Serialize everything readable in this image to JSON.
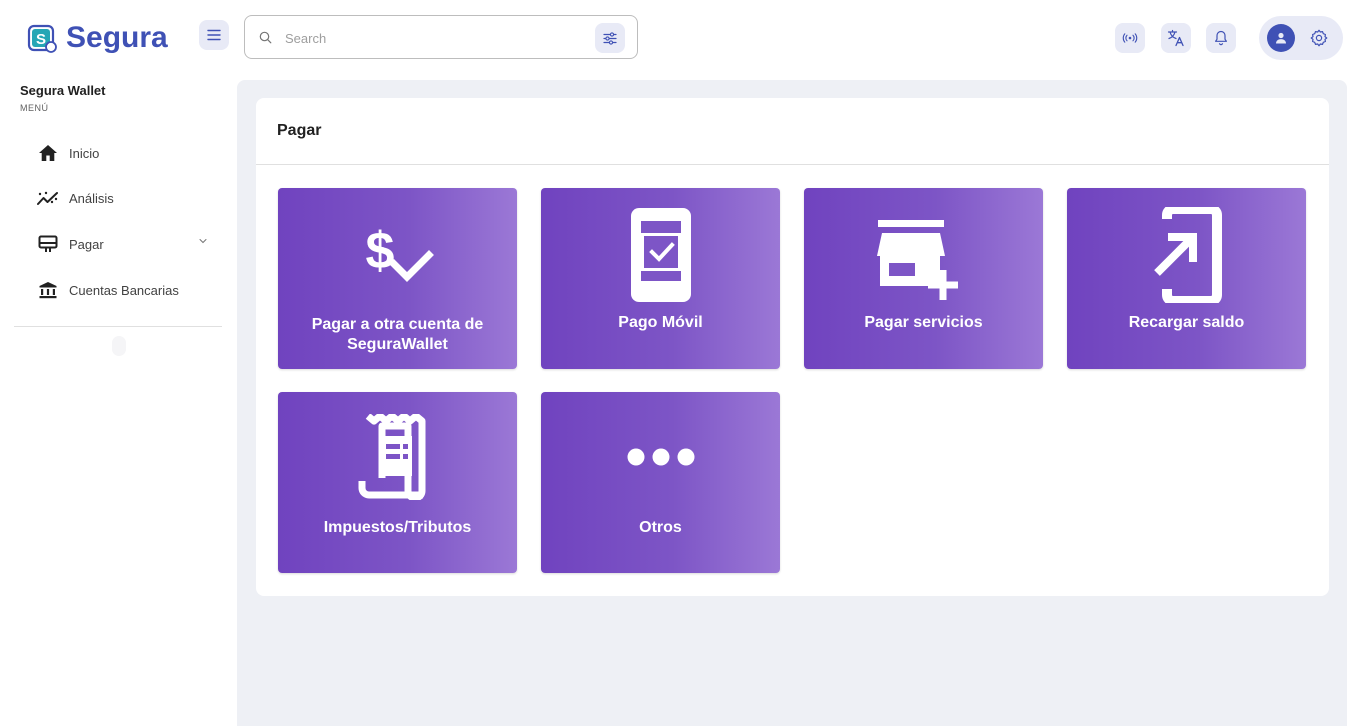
{
  "app": {
    "name": "Segura"
  },
  "search": {
    "placeholder": "Search",
    "value": ""
  },
  "sidebar": {
    "title": "Segura Wallet",
    "subtitle": "MENÚ",
    "items": [
      {
        "label": "Inicio",
        "icon": "home-icon"
      },
      {
        "label": "Análisis",
        "icon": "analytics-icon"
      },
      {
        "label": "Pagar",
        "icon": "payment-icon",
        "expandable": true
      },
      {
        "label": "Cuentas Bancarias",
        "icon": "bank-icon"
      }
    ]
  },
  "page": {
    "title": "Pagar",
    "tiles": [
      {
        "label": "Pagar a otra cuenta de SeguraWallet",
        "icon": "dollar-check-icon"
      },
      {
        "label": "Pago Móvil",
        "icon": "mobile-check-icon"
      },
      {
        "label": "Pagar servicios",
        "icon": "store-add-icon"
      },
      {
        "label": "Recargar saldo",
        "icon": "login-arrow-icon"
      },
      {
        "label": "Impuestos/Tributos",
        "icon": "receipt-icon"
      },
      {
        "label": "Otros",
        "icon": "more-horizontal-icon"
      }
    ]
  },
  "colors": {
    "brand": "#3f51b5",
    "tile_gradient_start": "#7043bf",
    "tile_gradient_end": "#9b78d6",
    "background": "#eef0f5"
  }
}
